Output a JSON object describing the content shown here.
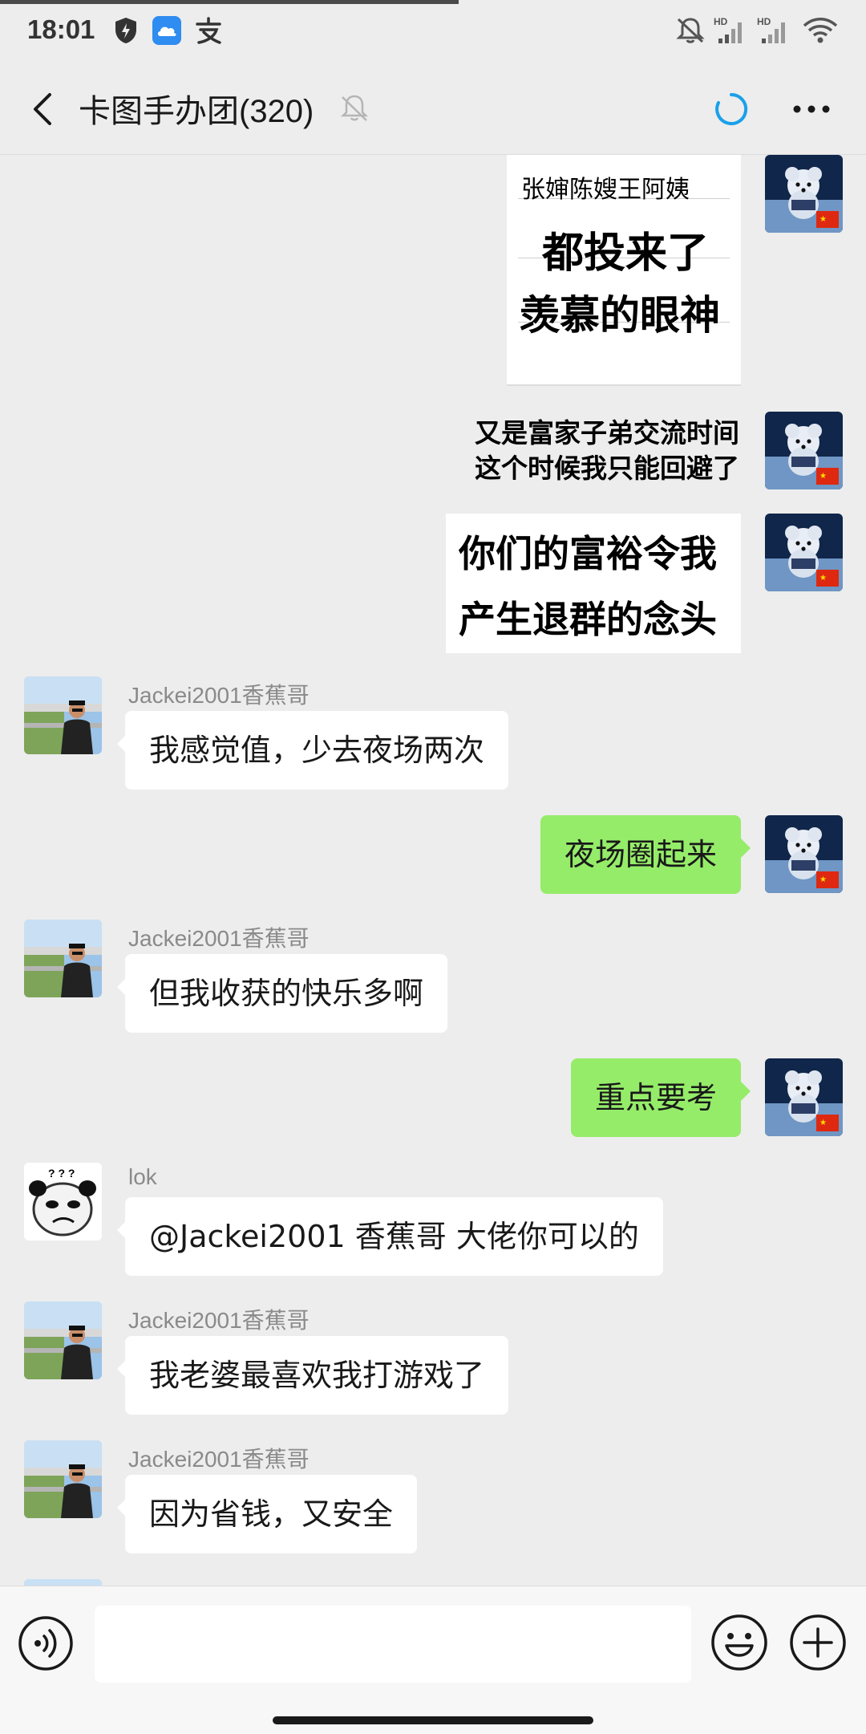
{
  "status_bar": {
    "time": "18:01",
    "network": "HD",
    "network2": "HD"
  },
  "header": {
    "title": "卡图手办团(320)"
  },
  "stickers": {
    "sticker1": {
      "line1": "张婶陈嫂王阿姨",
      "line2": "都投来了",
      "line3": "羡慕的眼神"
    },
    "sticker2": {
      "line1": "又是富家子弟交流时间",
      "line2": "这个时候我只能回避了"
    },
    "sticker3": {
      "line1": "你们的富裕令我",
      "line2": "产生退群的念头"
    }
  },
  "messages": [
    {
      "id": "m1",
      "sender": "Jackei2001香蕉哥",
      "direction": "in",
      "text": "我感觉值，少去夜场两次"
    },
    {
      "id": "m2",
      "sender": "",
      "direction": "out",
      "text": "夜场圈起来"
    },
    {
      "id": "m3",
      "sender": "Jackei2001香蕉哥",
      "direction": "in",
      "text": "但我收获的快乐多啊"
    },
    {
      "id": "m4",
      "sender": "",
      "direction": "out",
      "text": "重点要考"
    },
    {
      "id": "m5",
      "sender": "lok",
      "direction": "in",
      "text": "@Jackei2001 香蕉哥  大佬你可以的"
    },
    {
      "id": "m6",
      "sender": "Jackei2001香蕉哥",
      "direction": "in",
      "text": "我老婆最喜欢我打游戏了"
    },
    {
      "id": "m7",
      "sender": "Jackei2001香蕉哥",
      "direction": "in",
      "text": "因为省钱，又安全"
    }
  ],
  "panda_avatar_text": "? ? ?",
  "input": {
    "value": "",
    "placeholder": ""
  },
  "icons": {
    "back": "chevron-left-icon",
    "mute": "bell-off-icon",
    "loading": "spinner-icon",
    "more": "more-horizontal-icon",
    "voice": "voice-input-icon",
    "emoji": "emoji-icon",
    "plus": "plus-icon"
  },
  "colors": {
    "out_bubble": "#95ec69",
    "in_bubble": "#ffffff",
    "background": "#ededed",
    "spinner": "#1aa0ea"
  }
}
